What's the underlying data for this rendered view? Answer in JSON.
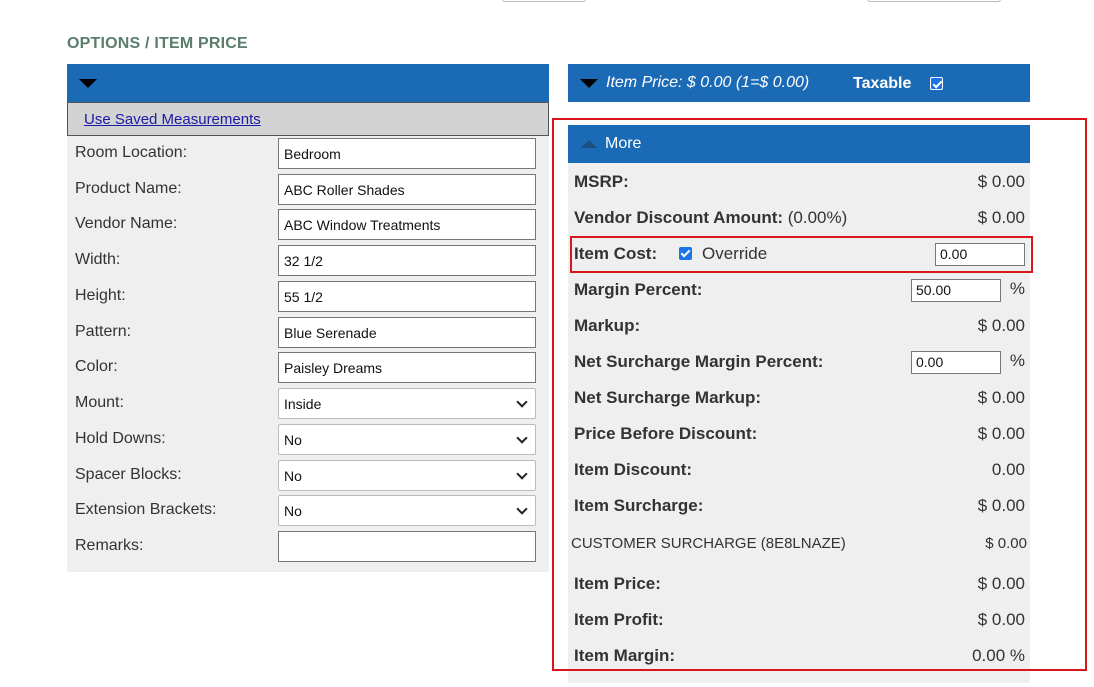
{
  "section_title": "OPTIONS / ITEM PRICE",
  "left": {
    "saved_link": "Use Saved Measurements",
    "fields": [
      {
        "label": "Room Location:",
        "value": "Bedroom",
        "type": "text"
      },
      {
        "label": "Product Name:",
        "value": "ABC Roller Shades",
        "type": "text"
      },
      {
        "label": "Vendor Name:",
        "value": "ABC Window Treatments",
        "type": "text"
      },
      {
        "label": "Width:",
        "value": "32 1/2",
        "type": "text"
      },
      {
        "label": "Height:",
        "value": "55 1/2",
        "type": "text"
      },
      {
        "label": "Pattern:",
        "value": "Blue Serenade",
        "type": "text"
      },
      {
        "label": "Color:",
        "value": "Paisley Dreams",
        "type": "text"
      },
      {
        "label": "Mount:",
        "value": "Inside",
        "type": "select"
      },
      {
        "label": "Hold Downs:",
        "value": "No",
        "type": "select"
      },
      {
        "label": "Spacer Blocks:",
        "value": "No",
        "type": "select"
      },
      {
        "label": "Extension Brackets:",
        "value": "No",
        "type": "select"
      },
      {
        "label": "Remarks:",
        "value": "",
        "type": "text"
      }
    ]
  },
  "price_header": {
    "item_price": "Item Price: $ 0.00 (1=$ 0.00)",
    "taxable_label": "Taxable",
    "taxable_checked": true
  },
  "more": {
    "toggle_label": "More",
    "msrp": {
      "label": "MSRP:",
      "value": "$ 0.00"
    },
    "vendor_discount": {
      "label": "Vendor Discount Amount:",
      "pct": "(0.00%)",
      "value": "$ 0.00"
    },
    "item_cost": {
      "label": "Item Cost:",
      "override_label": "Override",
      "override_checked": true,
      "value": "0.00"
    },
    "margin_percent": {
      "label": "Margin Percent:",
      "value": "50.00",
      "unit": "%"
    },
    "markup": {
      "label": "Markup:",
      "value": "$ 0.00"
    },
    "net_surcharge_margin": {
      "label": "Net Surcharge Margin Percent:",
      "value": "0.00",
      "unit": "%"
    },
    "net_surcharge_markup": {
      "label": "Net Surcharge Markup:",
      "value": "$ 0.00"
    },
    "price_before_discount": {
      "label": "Price Before Discount:",
      "value": "$ 0.00"
    },
    "item_discount": {
      "label": "Item Discount:",
      "value": "0.00"
    },
    "item_surcharge": {
      "label": "Item Surcharge:",
      "value": "$ 0.00"
    },
    "customer_surcharge": {
      "label": "CUSTOMER SURCHARGE (8E8LNAZE)",
      "value": "$ 0.00"
    },
    "item_price": {
      "label": "Item Price:",
      "value": "$ 0.00"
    },
    "item_profit": {
      "label": "Item Profit:",
      "value": "$ 0.00"
    },
    "item_margin": {
      "label": "Item Margin:",
      "value": "0.00 %"
    }
  },
  "colors": {
    "header_blue": "#1a6ab5",
    "panel_gray": "#efefef",
    "highlight_red": "#d9151e",
    "title_green": "#5a7d6c"
  }
}
